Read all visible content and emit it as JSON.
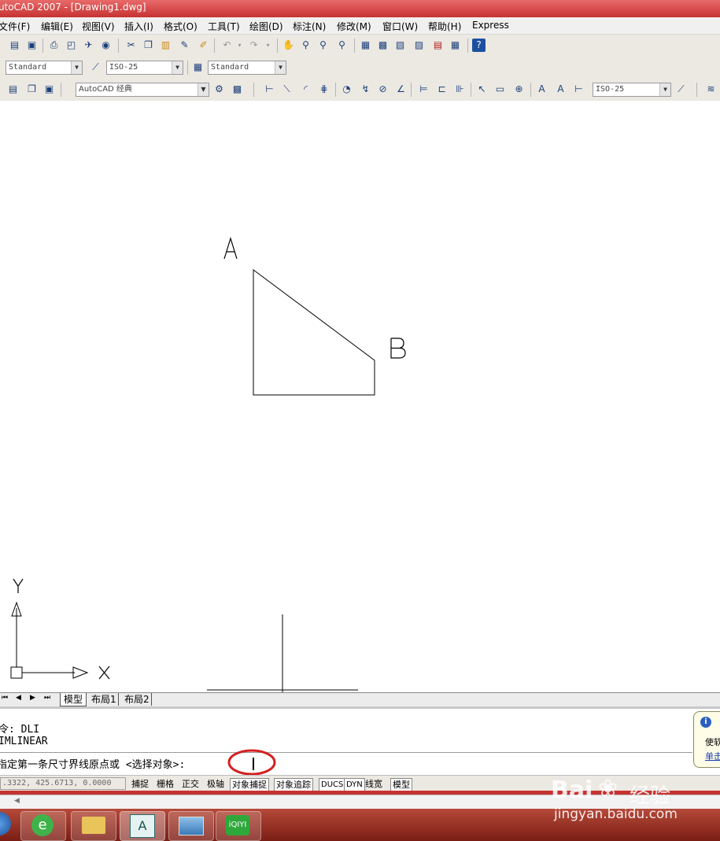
{
  "window": {
    "title": "utoCAD 2007 - [Drawing1.dwg]"
  },
  "menu": [
    "文件(F)",
    "编辑(E)",
    "视图(V)",
    "插入(I)",
    "格式(O)",
    "工具(T)",
    "绘图(D)",
    "标注(N)",
    "修改(M)",
    "窗口(W)",
    "帮助(H)",
    "Express"
  ],
  "styles_toolbar": {
    "text_style": "Standard",
    "dim_style": "ISO-25",
    "table_style": "Standard"
  },
  "workspace_toolbar": {
    "workspace": "AutoCAD 经典",
    "dim_style": "ISO-25"
  },
  "drawing": {
    "label_a": "A",
    "label_b": "B"
  },
  "ucs": {
    "x_label": "X",
    "y_label": "Y"
  },
  "tabs": {
    "model": "模型",
    "layout1": "布局1",
    "layout2": "布局2"
  },
  "command": {
    "line1": "令: DLI",
    "line2": "IMLINEAR",
    "prompt": "指定第一条尺寸界线原点或 <选择对象>:"
  },
  "notification": {
    "line1": "使软",
    "line2": "单击"
  },
  "status": {
    "coords": ".3322, 425.6713, 0.0000",
    "buttons": [
      "捕捉",
      "栅格",
      "正交",
      "极轴",
      "对象捕捉",
      "对象追踪",
      "DUCS",
      "DYN",
      "线宽",
      "模型"
    ]
  },
  "watermark": {
    "brand": "Bai",
    "suffix": "经验",
    "url": "jingyan.baidu.com"
  },
  "colors": {
    "titlebar": "#c73232",
    "taskbar": "#8f2a1f",
    "annotation_circle": "#d42020"
  }
}
